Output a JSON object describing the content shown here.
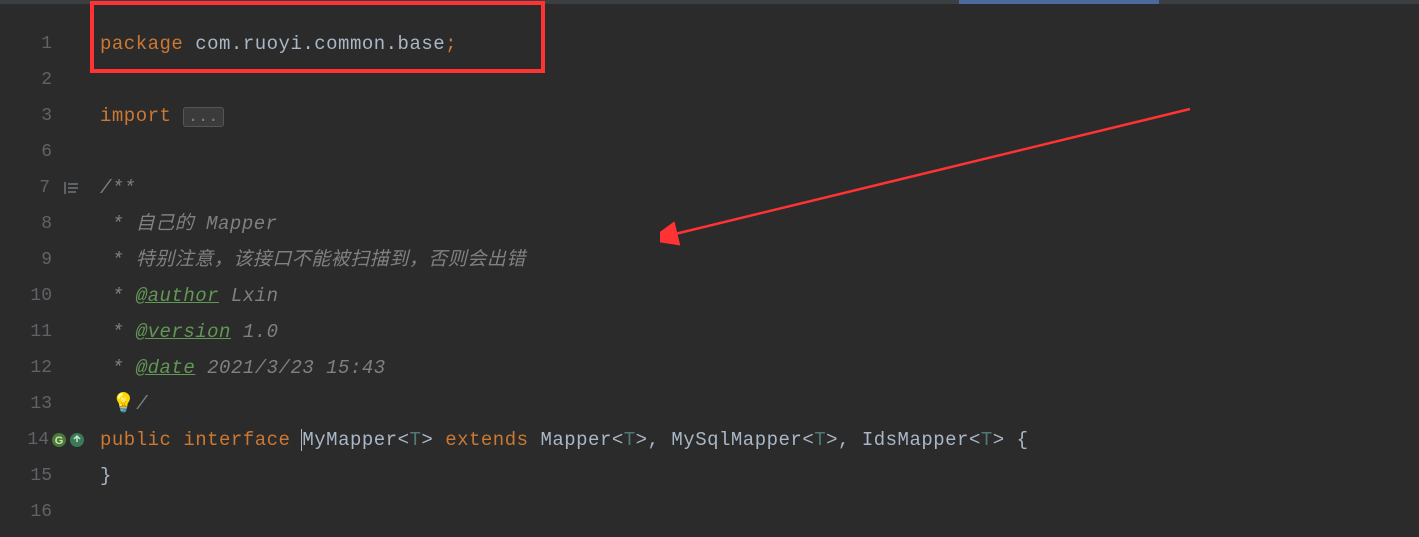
{
  "lines": {
    "l1": "1",
    "l2": "2",
    "l3": "3",
    "l6": "6",
    "l7": "7",
    "l8": "8",
    "l9": "9",
    "l10": "10",
    "l11": "11",
    "l12": "12",
    "l13": "13",
    "l14": "14",
    "l15": "15",
    "l16": "16"
  },
  "code": {
    "kw_package": "package",
    "pkg_name": " com.ruoyi.common.base",
    "semicolon": ";",
    "kw_import": "import ",
    "folded": "...",
    "comment_start": "/**",
    "comment_l8_pre": " * ",
    "comment_l8": "自己的 Mapper",
    "comment_l9_pre": " * ",
    "comment_l9": "特别注意，该接口不能被扫描到，否则会出错",
    "comment_l10_pre": " * ",
    "tag_author": "@author",
    "author_val": " Lxin",
    "comment_l11_pre": " * ",
    "tag_version": "@version",
    "version_val": " 1.0",
    "comment_l12_pre": " * ",
    "tag_date": "@date",
    "date_val": " 2021/3/23 15:43",
    "comment_end_slash": "/",
    "kw_public": "public",
    "space1": " ",
    "kw_interface": "interface",
    "space2": " ",
    "class_name": "MyMapper",
    "angle_open": "<",
    "type_t": "T",
    "angle_close": ">",
    "kw_extends": "extends",
    "mapper_t": "Mapper",
    "mysql_t": "MySqlMapper",
    "ids_t": "IdsMapper",
    "comma_sp": ", ",
    "brace_open": " {",
    "brace_close": "}"
  }
}
